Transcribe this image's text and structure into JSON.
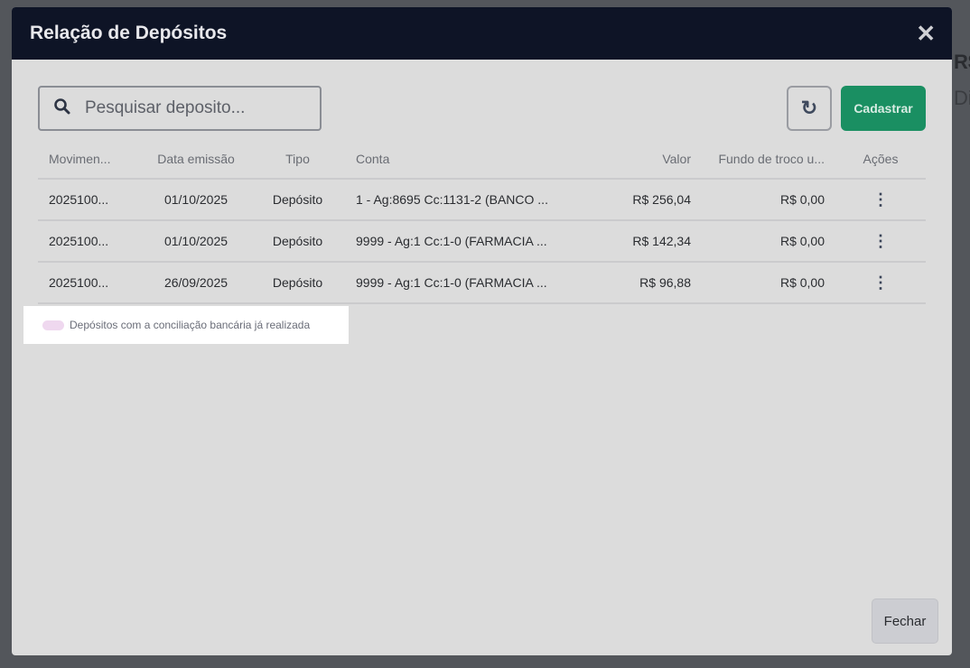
{
  "modal": {
    "title": "Relação de Depósitos",
    "search_placeholder": "Pesquisar deposito...",
    "register_label": "Cadastrar",
    "close_label": "Fechar"
  },
  "columns": [
    "Movimen...",
    "Data emissão",
    "Tipo",
    "Conta",
    "Valor",
    "Fundo de troco u...",
    "Ações"
  ],
  "rows": [
    {
      "mov": "2025100...",
      "data": "01/10/2025",
      "tipo": "Depósito",
      "conta": "1 - Ag:8695 Cc:1131-2 (BANCO ...",
      "valor": "R$ 256,04",
      "fundo": "R$ 0,00"
    },
    {
      "mov": "2025100...",
      "data": "01/10/2025",
      "tipo": "Depósito",
      "conta": "9999 - Ag:1 Cc:1-0 (FARMACIA ...",
      "valor": "R$ 142,34",
      "fundo": "R$ 0,00"
    },
    {
      "mov": "2025100...",
      "data": "26/09/2025",
      "tipo": "Depósito",
      "conta": "9999 - Ag:1 Cc:1-0 (FARMACIA ...",
      "valor": "R$ 96,88",
      "fundo": "R$ 0,00"
    }
  ],
  "legend": "Depósitos com a conciliação bancária já realizada",
  "background": {
    "frag1": "R$",
    "frag2": "Dif"
  }
}
